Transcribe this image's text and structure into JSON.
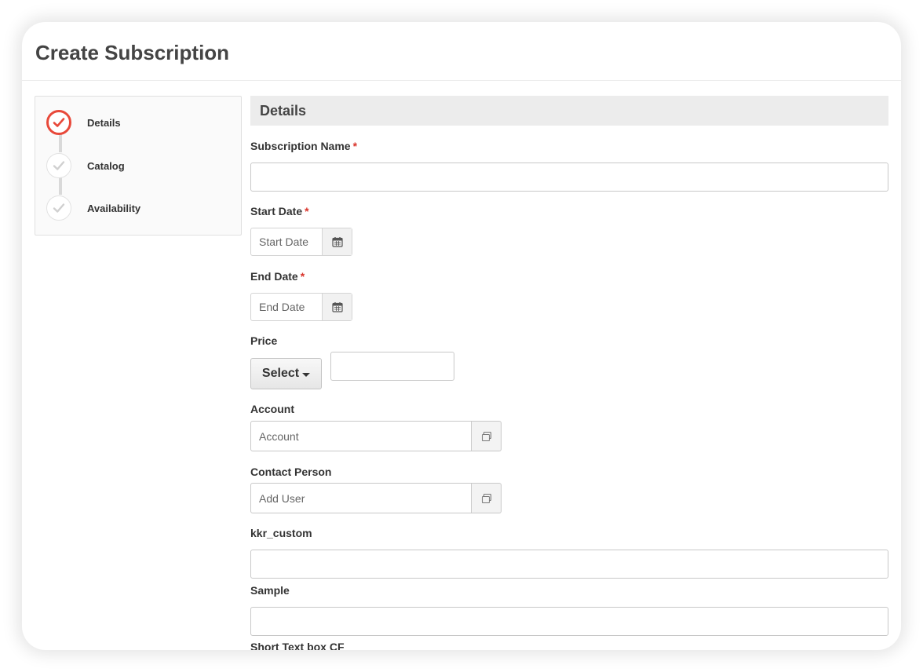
{
  "page_title": "Create Subscription",
  "steps": [
    {
      "label": "Details",
      "state": "active"
    },
    {
      "label": "Catalog",
      "state": "inactive"
    },
    {
      "label": "Availability",
      "state": "inactive"
    }
  ],
  "section_title": "Details",
  "fields": {
    "subscription_name": {
      "label": "Subscription Name",
      "required_mark": "*",
      "value": ""
    },
    "start_date": {
      "label": "Start Date",
      "required_mark": "*",
      "placeholder": "Start Date"
    },
    "end_date": {
      "label": "End Date",
      "required_mark": "*",
      "placeholder": "End Date"
    },
    "price": {
      "label": "Price",
      "select_label": "Select",
      "value": ""
    },
    "account": {
      "label": "Account",
      "placeholder": "Account"
    },
    "contact_person": {
      "label": "Contact Person",
      "placeholder": "Add User"
    },
    "kkr_custom": {
      "label": "kkr_custom",
      "value": ""
    },
    "sample": {
      "label": "Sample",
      "value": ""
    },
    "short_text_box": {
      "label": "Short Text box CF"
    }
  },
  "colors": {
    "accent": "#e8493a",
    "required": "#d9342b"
  },
  "icons": {
    "step_check": "check-icon",
    "date_picker": "calendar-icon",
    "lookup": "lookup-window-icon",
    "select": "caret-down-icon"
  }
}
